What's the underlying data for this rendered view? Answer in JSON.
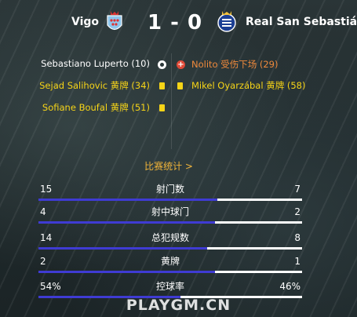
{
  "match": {
    "home_team": "Vigo",
    "away_team": "Real San Sebastián",
    "score": "1 - 0"
  },
  "events": {
    "home": [
      {
        "text": "Sebastiano Luperto (10)",
        "icon": "gear-icon",
        "color": "#ffffff"
      },
      {
        "text": "Sejad Salihovic 黄牌 (34)",
        "icon": "yellow-card-icon",
        "color": "#f6d417"
      },
      {
        "text": "Sofiane Boufal 黄牌 (51)",
        "icon": "yellow-card-icon",
        "color": "#f6d417"
      }
    ],
    "away": [
      {
        "text": "Nolito 受伤下场 (29)",
        "icon": "injury-icon",
        "color": "#f08a3c"
      },
      {
        "text": "Mikel Oyarzábal 黄牌 (58)",
        "icon": "yellow-card-icon",
        "color": "#f6d417"
      }
    ]
  },
  "stats_link": "比赛统计 >",
  "stats": [
    {
      "label": "射门数",
      "home": "15",
      "away": "7",
      "home_share": 0.68
    },
    {
      "label": "射中球门",
      "home": "4",
      "away": "2",
      "home_share": 0.67
    },
    {
      "label": "总犯规数",
      "home": "14",
      "away": "8",
      "home_share": 0.64
    },
    {
      "label": "黄牌",
      "home": "2",
      "away": "1",
      "home_share": 0.67
    },
    {
      "label": "控球率",
      "home": "54%",
      "away": "46%",
      "home_share": 0.54
    }
  ],
  "watermark": "PLAYGM.CN",
  "colors": {
    "accent_orange": "#f2b53a",
    "yellow_card": "#f6d417",
    "bar_home": "#3f3bd3",
    "bar_away": "#ffffff"
  }
}
